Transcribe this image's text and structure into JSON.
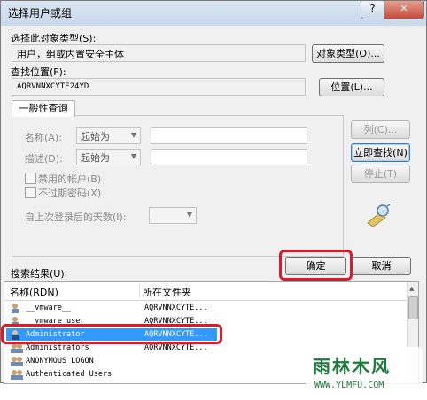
{
  "window": {
    "title": "选择用户或组",
    "help_glyph": "?",
    "close_glyph": "✕"
  },
  "object_type": {
    "label": "选择此对象类型(S):",
    "value": "用户，组或内置安全主体",
    "button": "对象类型(O)..."
  },
  "location": {
    "label": "查找位置(F):",
    "value": "AQRVNNXCYTE24YD",
    "button": "位置(L)..."
  },
  "tab": "一般性查询",
  "query": {
    "name_label": "名称(A):",
    "name_op": "起始为",
    "desc_label": "描述(D):",
    "desc_op": "起始为",
    "disabled_accounts": "禁用的帐户(B)",
    "non_expiring_pw": "不过期密码(X)",
    "days_label": "自上次登录后的天数(I):"
  },
  "side_buttons": {
    "columns": "列(C)...",
    "find_now": "立即查找(N)",
    "stop": "停止(T)"
  },
  "dialog_buttons": {
    "ok": "确定",
    "cancel": "取消"
  },
  "results": {
    "label": "搜索结果(U):",
    "col_name": "名称(RDN)",
    "col_folder": "所在文件夹",
    "rows": [
      {
        "name": "__vmware__",
        "folder": "AQRVNNXCYTE..."
      },
      {
        "name": "__vmware_user",
        "folder": "AQRVNNXCYTE..."
      },
      {
        "name": "Administrator",
        "folder": "AQRVNNXCYTE..."
      },
      {
        "name": "Administrators",
        "folder": "AQRVNNXCYTE..."
      },
      {
        "name": "ANONYMOUS LOGON",
        "folder": ""
      },
      {
        "name": "Authenticated Users",
        "folder": ""
      }
    ]
  },
  "watermark": {
    "brand": "雨林木风",
    "url": "WWW.YLMFU.COM"
  },
  "colors": {
    "highlight": "#e0182c",
    "selection": "#3399ff"
  }
}
